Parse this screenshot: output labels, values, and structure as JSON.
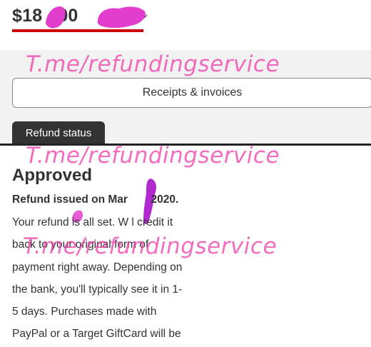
{
  "header": {
    "price_left": "$18",
    "price_right": "00",
    "chevron_icon": "chevron-down-icon",
    "accent_color": "#cc0000"
  },
  "buttons": {
    "receipts_label": "Receipts & invoices"
  },
  "tabs": {
    "refund_status_label": "Refund status"
  },
  "refund": {
    "status": "Approved",
    "issued_left": "Refund issued on Mar",
    "issued_right": "2020.",
    "body_lines": [
      "Your refund is all set. W    l credit it",
      "back to your original form of",
      "payment right away. Depending on",
      "the bank, you'll typically see it in 1-",
      "5 days. Purchases made with",
      "PayPal or a Target GiftCard will be"
    ]
  },
  "watermark": {
    "text": "T.me/refundingservice",
    "color": "#f03ca8"
  }
}
